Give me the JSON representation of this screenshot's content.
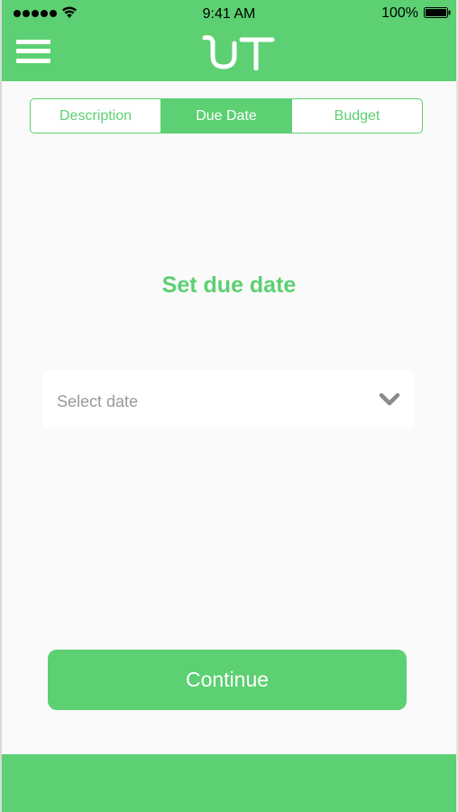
{
  "status": {
    "time": "9:41 AM",
    "battery": "100%",
    "signal_bars": 5
  },
  "header": {
    "logo_text": "UT",
    "menu_icon": "hamburger-icon",
    "brand_color": "#5cd072"
  },
  "tabs": [
    {
      "label": "Description",
      "active": false
    },
    {
      "label": "Due Date",
      "active": true
    },
    {
      "label": "Budget",
      "active": false
    }
  ],
  "main": {
    "title": "Set due date",
    "date_select": {
      "placeholder": "Select date",
      "icon": "chevron-down-icon"
    },
    "continue_label": "Continue"
  }
}
